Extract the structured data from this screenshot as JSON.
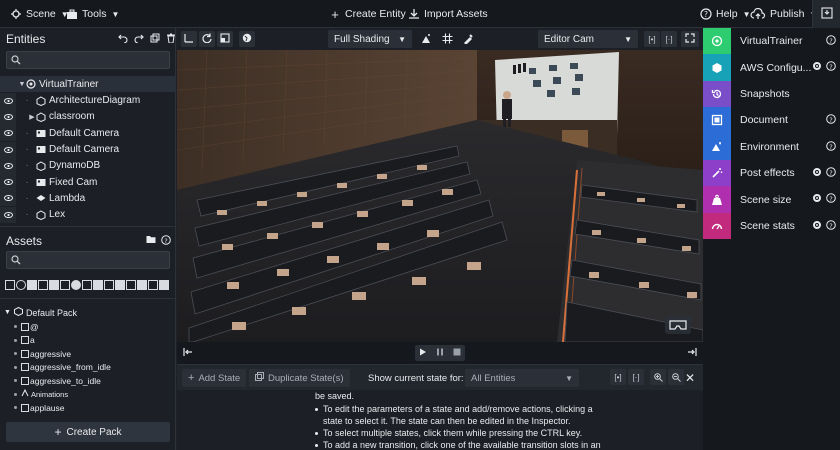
{
  "topbar": {
    "scene_label": "Scene",
    "tools_label": "Tools",
    "create_entity_label": "Create Entity",
    "import_assets_label": "Import Assets",
    "help_label": "Help",
    "publish_label": "Publish"
  },
  "entities": {
    "title": "Entities",
    "items": [
      {
        "label": "VirtualTrainer",
        "icon": "scene-icon"
      },
      {
        "label": "ArchitectureDiagram",
        "icon": "entity-icon"
      },
      {
        "label": "classroom",
        "icon": "entity-icon"
      },
      {
        "label": "Default Camera",
        "icon": "camera-icon"
      },
      {
        "label": "Default Camera",
        "icon": "camera-icon"
      },
      {
        "label": "DynamoDB",
        "icon": "entity-icon"
      },
      {
        "label": "Fixed Cam",
        "icon": "camera-icon"
      },
      {
        "label": "Lambda",
        "icon": "lambda-icon"
      },
      {
        "label": "Lex",
        "icon": "entity-icon"
      }
    ]
  },
  "assets": {
    "title": "Assets",
    "pack_label": "Default Pack",
    "items": [
      "@",
      "a",
      "aggressive",
      "aggressive_from_idle",
      "aggressive_to_idle",
      "Animations",
      "applause"
    ],
    "create_pack_label": "Create Pack"
  },
  "viewport": {
    "shading_label": "Full Shading",
    "camera_label": "Editor Cam"
  },
  "state_machine": {
    "add_state_label": "Add State",
    "duplicate_state_label": "Duplicate State(s)",
    "show_current_label": "Show current state for:",
    "filter_value": "All Entities",
    "lines": [
      "be saved.",
      "To edit the parameters of a state and add/remove actions, clicking a",
      "state to select it. The state can then be edited in the Inspector.",
      "To select multiple states, click them while pressing the CTRL key.",
      "To add a new transition, click one of the available transition slots in an"
    ]
  },
  "sidebar": {
    "items": [
      {
        "label": "VirtualTrainer",
        "color": "#2ecc71",
        "icon": "target-icon"
      },
      {
        "label": "AWS Configu...",
        "color": "#17a2b8",
        "icon": "cube-icon"
      },
      {
        "label": "Snapshots",
        "color": "#7b4ec9",
        "icon": "history-icon"
      },
      {
        "label": "Document",
        "color": "#2b6cd6",
        "icon": "document-icon"
      },
      {
        "label": "Environment",
        "color": "#2b6cd6",
        "icon": "environment-icon"
      },
      {
        "label": "Post effects",
        "color": "#8e3fc9",
        "icon": "wand-icon"
      },
      {
        "label": "Scene size",
        "color": "#b02fae",
        "icon": "weight-icon"
      },
      {
        "label": "Scene stats",
        "color": "#c22a7d",
        "icon": "gauge-icon"
      }
    ]
  }
}
